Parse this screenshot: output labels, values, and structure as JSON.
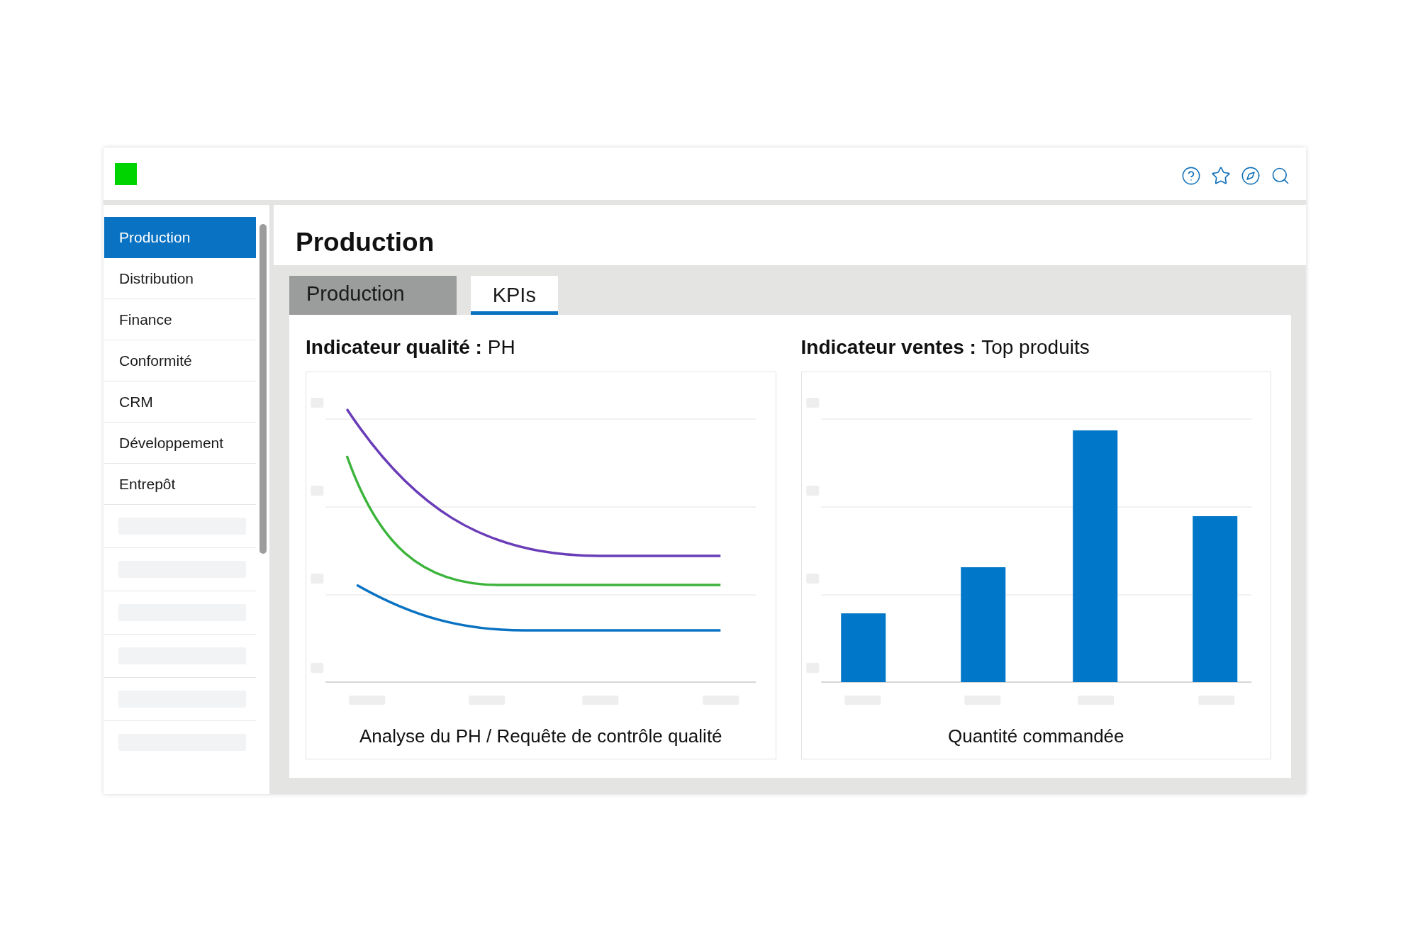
{
  "sidebar": {
    "items": [
      {
        "label": "Production",
        "selected": true
      },
      {
        "label": "Distribution",
        "selected": false
      },
      {
        "label": "Finance",
        "selected": false
      },
      {
        "label": "Conformité",
        "selected": false
      },
      {
        "label": "CRM",
        "selected": false
      },
      {
        "label": "Développement",
        "selected": false
      },
      {
        "label": "Entrepôt",
        "selected": false
      }
    ]
  },
  "page": {
    "title": "Production"
  },
  "tabs": [
    {
      "label": "Production",
      "selected": false
    },
    {
      "label": "KPIs",
      "selected": true
    }
  ],
  "charts": [
    {
      "kind": "line",
      "title": "**Indicateur qualité :** PH",
      "caption": "Analyse du PH / Requête de contrôle qualité"
    },
    {
      "kind": "bar",
      "title": "**Indicateur ventes :** Top produits",
      "caption": "Quantité commandée"
    }
  ]
}
